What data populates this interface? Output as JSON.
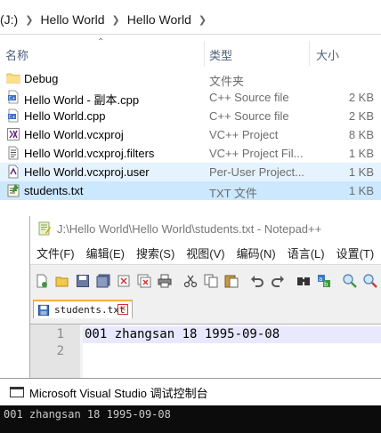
{
  "explorer": {
    "breadcrumb": [
      "(J:)",
      "Hello World",
      "Hello World"
    ],
    "columns": {
      "name": "名称",
      "type": "类型",
      "size": "大小"
    },
    "files": [
      {
        "name": "Debug",
        "type": "文件夹",
        "size": "",
        "icon": "folder-icon"
      },
      {
        "name": "Hello World - 副本.cpp",
        "type": "C++ Source file",
        "size": "2 KB",
        "icon": "cpp-file-icon"
      },
      {
        "name": "Hello World.cpp",
        "type": "C++ Source file",
        "size": "2 KB",
        "icon": "cpp-file-icon"
      },
      {
        "name": "Hello World.vcxproj",
        "type": "VC++ Project",
        "size": "8 KB",
        "icon": "vcxproj-file-icon"
      },
      {
        "name": "Hello World.vcxproj.filters",
        "type": "VC++ Project Fil...",
        "size": "1 KB",
        "icon": "filters-file-icon"
      },
      {
        "name": "Hello World.vcxproj.user",
        "type": "Per-User Project...",
        "size": "1 KB",
        "icon": "user-file-icon"
      },
      {
        "name": "students.txt",
        "type": "TXT 文件",
        "size": "1 KB",
        "icon": "text-file-icon"
      }
    ]
  },
  "notepad": {
    "title": "J:\\Hello World\\Hello World\\students.txt - Notepad++",
    "menu": [
      "文件(F)",
      "编辑(E)",
      "搜索(S)",
      "视图(V)",
      "编码(N)",
      "语言(L)",
      "设置(T)",
      "工"
    ],
    "tab_label": "students.txt",
    "close_glyph": "✕",
    "line_numbers": [
      "1",
      "2"
    ],
    "line1": "001 zhangsan 18 1995-09-08"
  },
  "console": {
    "title": "Microsoft Visual Studio 调试控制台",
    "output": "001 zhangsan 18 1995-09-08"
  },
  "colors": {
    "hover_row": "#e5f3ff",
    "selected_row": "#cce8ff",
    "console_bg": "#0c0c0c",
    "active_tab_border": "#f0b040"
  }
}
